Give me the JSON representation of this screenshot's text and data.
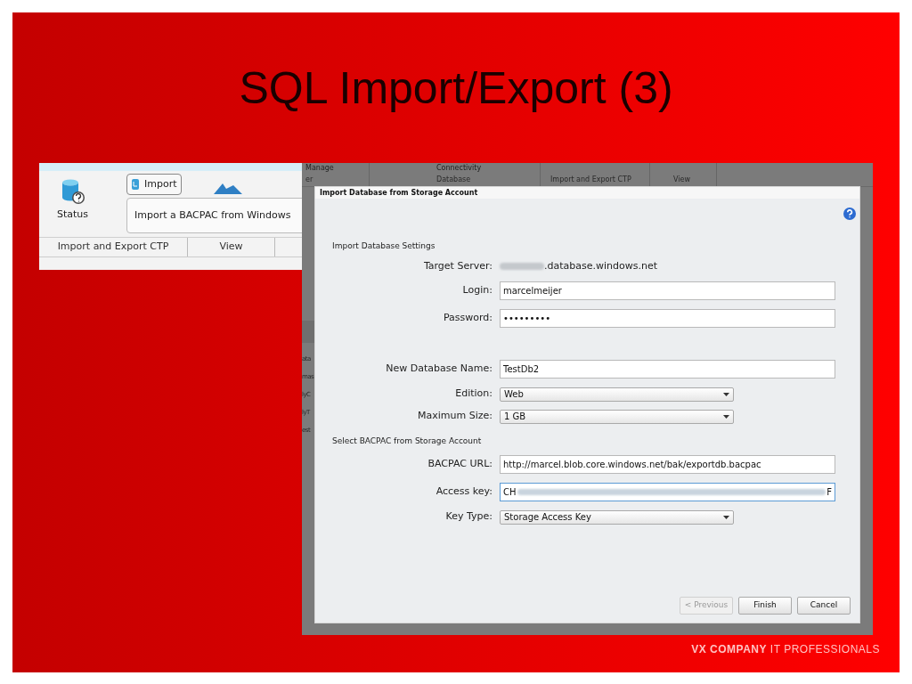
{
  "slide": {
    "title": "SQL Import/Export (3)",
    "footer": "**VX COMPANY** IT PROFESSIONALS"
  },
  "ribbon_screenshot": {
    "status_button": {
      "label": "Status"
    },
    "import_button": {
      "label": "Import"
    },
    "tooltip": "Import a BACPAC from Windows",
    "groups": [
      "Import and Export CTP",
      "View"
    ]
  },
  "app_screenshot": {
    "ribbon_columns": [
      {
        "top": "Manage",
        "bottom": "er"
      },
      {
        "top": "Connectivity",
        "bottom": "Database"
      },
      {
        "bottom": "Import and Export CTP"
      },
      {
        "bottom": "View"
      }
    ],
    "background_fragments": [
      "ata",
      "mas",
      "lyC",
      "lyT",
      "est"
    ],
    "dialog": {
      "title": "Import Database from Storage Account",
      "sections": [
        {
          "heading": "Import Database Settings",
          "fields": [
            {
              "label": "Target Server:",
              "kind": "readonly_redacted",
              "value": ".database.windows.net"
            },
            {
              "label": "Login:",
              "kind": "text",
              "value": "marcelmeijer",
              "focused": false
            },
            {
              "label": "Password:",
              "kind": "text",
              "value": "•••••••••",
              "focused": false
            }
          ]
        },
        {
          "fields": [
            {
              "label": "New Database Name:",
              "kind": "text",
              "value": "TestDb2",
              "focused": false
            },
            {
              "label": "Edition:",
              "kind": "select",
              "value": "Web"
            },
            {
              "label": "Maximum Size:",
              "kind": "select",
              "value": "1 GB"
            }
          ]
        },
        {
          "heading": "Select BACPAC from Storage Account",
          "fields": [
            {
              "label": "BACPAC URL:",
              "kind": "text",
              "value": "http://marcel.blob.core.windows.net/bak/exportdb.bacpac",
              "focused": false
            },
            {
              "label": "Access key:",
              "kind": "redacted_input",
              "value_start": "CH",
              "value_end": "F",
              "focused": true
            },
            {
              "label": "Key Type:",
              "kind": "select",
              "value": "Storage Access Key"
            }
          ]
        }
      ],
      "buttons": [
        {
          "label": "< Previous",
          "disabled": true
        },
        {
          "label": "Finish",
          "disabled": false
        },
        {
          "label": "Cancel",
          "disabled": false
        }
      ]
    }
  }
}
